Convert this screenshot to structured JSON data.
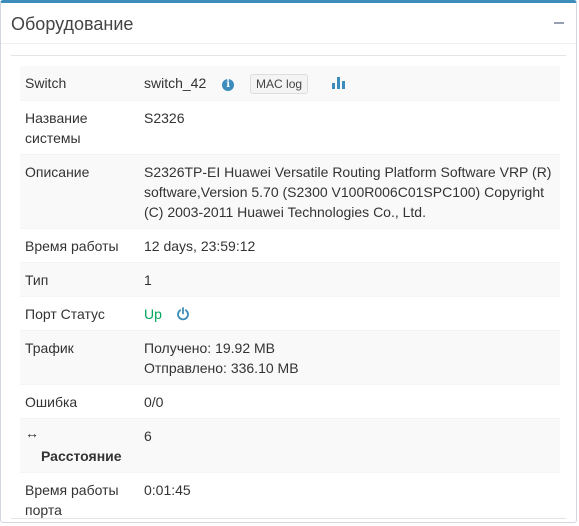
{
  "panel": {
    "title": "Оборудование",
    "collapse_icon": "minus-icon"
  },
  "rows": {
    "switch": {
      "label": "Switch",
      "value": "switch_42",
      "info_icon": "info-circle-icon",
      "mac_log_label": "MAC log",
      "chart_icon": "bar-chart-icon"
    },
    "system_name": {
      "label": "Название системы",
      "value": "S2326"
    },
    "description": {
      "label": "Описание",
      "value": "S2326TP-EI Huawei Versatile Routing Platform Software VRP (R) software,Version 5.70 (S2300 V100R006C01SPC100) Copyright (C) 2003-2011 Huawei Technologies Co., Ltd."
    },
    "uptime": {
      "label": "Время работы",
      "value": "12 days, 23:59:12"
    },
    "type": {
      "label": "Тип",
      "value": "1"
    },
    "port_status": {
      "label": "Порт Статус",
      "value": "Up",
      "value_color": "#00a65a",
      "power_icon": "power-icon"
    },
    "traffic": {
      "label": "Трафик",
      "received": "Получено: 19.92 MB",
      "sent": "Отправлено: 336.10 MB"
    },
    "error": {
      "label": "Ошибка",
      "value": "0/0"
    },
    "distance": {
      "icon": "horizontal-arrows-icon",
      "label": "Расстояние",
      "value": "6"
    },
    "port_uptime": {
      "label": "Время работы порта",
      "value": "0:01:45"
    }
  },
  "colors": {
    "accent": "#3c8dbc",
    "success": "#00a65a"
  }
}
